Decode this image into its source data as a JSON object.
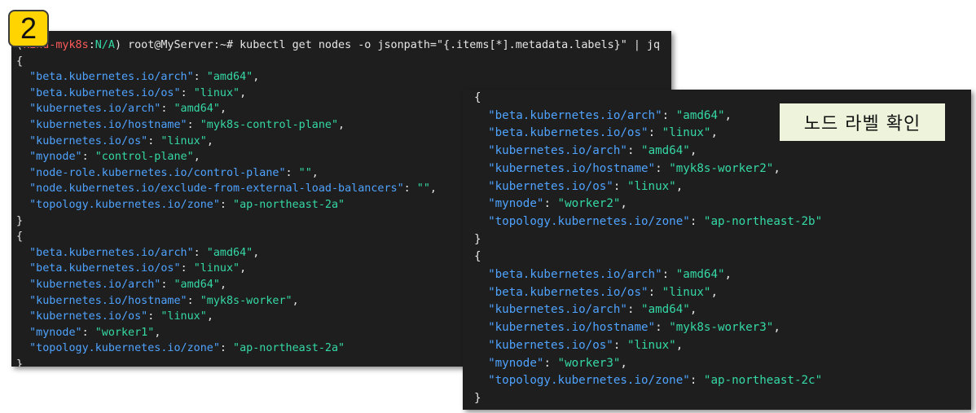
{
  "badge": {
    "number": "2"
  },
  "callout": {
    "text": "노드 라벨 확인"
  },
  "colors": {
    "key": "#4fa3ff",
    "string": "#35d9a5",
    "background": "#1e1e1e",
    "badge": "#ffd400",
    "callout_bg": "#eef3dc"
  },
  "left_terminal": {
    "prompt": {
      "open_paren": "(",
      "context_a": "kind-myk8s",
      "colon": ":",
      "context_b": "N/A",
      "rest": ") root@MyServer:~# ",
      "command": "kubectl get nodes -o jsonpath=\"{.items[*].metadata.labels}\" | jq"
    },
    "lines": [
      {
        "open": "{"
      },
      {
        "key": "\"beta.kubernetes.io/arch\"",
        "value": "\"amd64\"",
        "comma": true
      },
      {
        "key": "\"beta.kubernetes.io/os\"",
        "value": "\"linux\"",
        "comma": true
      },
      {
        "key": "\"kubernetes.io/arch\"",
        "value": "\"amd64\"",
        "comma": true
      },
      {
        "key": "\"kubernetes.io/hostname\"",
        "value": "\"myk8s-control-plane\"",
        "comma": true
      },
      {
        "key": "\"kubernetes.io/os\"",
        "value": "\"linux\"",
        "comma": true
      },
      {
        "key": "\"mynode\"",
        "value": "\"control-plane\"",
        "comma": true
      },
      {
        "key": "\"node-role.kubernetes.io/control-plane\"",
        "value": "\"\"",
        "comma": true
      },
      {
        "key": "\"node.kubernetes.io/exclude-from-external-load-balancers\"",
        "value": "\"\"",
        "comma": true
      },
      {
        "key": "\"topology.kubernetes.io/zone\"",
        "value": "\"ap-northeast-2a\"",
        "comma": false
      },
      {
        "close": "}"
      },
      {
        "open": "{"
      },
      {
        "key": "\"beta.kubernetes.io/arch\"",
        "value": "\"amd64\"",
        "comma": true
      },
      {
        "key": "\"beta.kubernetes.io/os\"",
        "value": "\"linux\"",
        "comma": true
      },
      {
        "key": "\"kubernetes.io/arch\"",
        "value": "\"amd64\"",
        "comma": true
      },
      {
        "key": "\"kubernetes.io/hostname\"",
        "value": "\"myk8s-worker\"",
        "comma": true
      },
      {
        "key": "\"kubernetes.io/os\"",
        "value": "\"linux\"",
        "comma": true
      },
      {
        "key": "\"mynode\"",
        "value": "\"worker1\"",
        "comma": true
      },
      {
        "key": "\"topology.kubernetes.io/zone\"",
        "value": "\"ap-northeast-2a\"",
        "comma": false
      },
      {
        "close": "}"
      }
    ]
  },
  "right_terminal": {
    "lines": [
      {
        "open": "{"
      },
      {
        "key": "\"beta.kubernetes.io/arch\"",
        "value": "\"amd64\"",
        "comma": true
      },
      {
        "key": "\"beta.kubernetes.io/os\"",
        "value": "\"linux\"",
        "comma": true
      },
      {
        "key": "\"kubernetes.io/arch\"",
        "value": "\"amd64\"",
        "comma": true
      },
      {
        "key": "\"kubernetes.io/hostname\"",
        "value": "\"myk8s-worker2\"",
        "comma": true
      },
      {
        "key": "\"kubernetes.io/os\"",
        "value": "\"linux\"",
        "comma": true
      },
      {
        "key": "\"mynode\"",
        "value": "\"worker2\"",
        "comma": true
      },
      {
        "key": "\"topology.kubernetes.io/zone\"",
        "value": "\"ap-northeast-2b\"",
        "comma": false
      },
      {
        "close": "}"
      },
      {
        "open": "{"
      },
      {
        "key": "\"beta.kubernetes.io/arch\"",
        "value": "\"amd64\"",
        "comma": true
      },
      {
        "key": "\"beta.kubernetes.io/os\"",
        "value": "\"linux\"",
        "comma": true
      },
      {
        "key": "\"kubernetes.io/arch\"",
        "value": "\"amd64\"",
        "comma": true
      },
      {
        "key": "\"kubernetes.io/hostname\"",
        "value": "\"myk8s-worker3\"",
        "comma": true
      },
      {
        "key": "\"kubernetes.io/os\"",
        "value": "\"linux\"",
        "comma": true
      },
      {
        "key": "\"mynode\"",
        "value": "\"worker3\"",
        "comma": true
      },
      {
        "key": "\"topology.kubernetes.io/zone\"",
        "value": "\"ap-northeast-2c\"",
        "comma": false
      },
      {
        "close": "}"
      }
    ]
  }
}
